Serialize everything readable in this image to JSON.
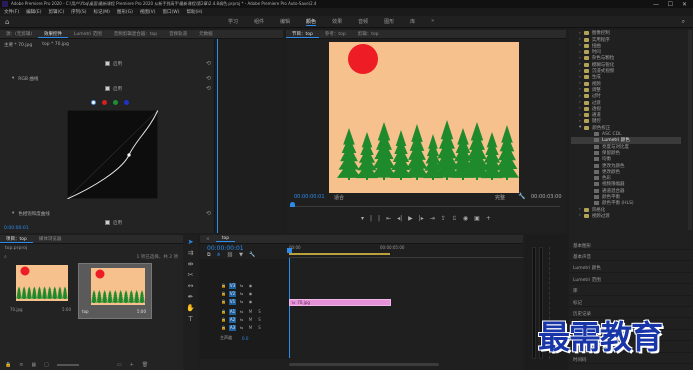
{
  "window": {
    "title": "Adobe Premiere Pro 2020 - C:\\用户\\Ybq\\桌面\\最新课程 Premiere Pro 2020 从新手到高手\\最新课程\\第2章\\2.4.8调色.prproj * - Adobe Premiere Pro Auto-Save\\2.4"
  },
  "menu": [
    "文件(F)",
    "编辑(E)",
    "剪辑(C)",
    "序列(S)",
    "标记(M)",
    "图形(G)",
    "视图(V)",
    "窗口(W)",
    "帮助(H)"
  ],
  "workspaces": [
    "学习",
    "组件",
    "编辑",
    "颜色",
    "效果",
    "音频",
    "图形",
    "库",
    "»"
  ],
  "effect_controls": {
    "tabs": [
      "源：(无剪辑)",
      "效果控件",
      "Lumetri 范围",
      "音频剪辑混合器：top",
      "音频轨道",
      "元数据"
    ],
    "source_label": "主要 * 70.jpg",
    "clip_label": "top * 70.jpg",
    "row_labels": [
      "RGB 曲线",
      "色相饱和度曲线"
    ],
    "checkbox_label": "启用",
    "colors": {
      "white": "#ffffff",
      "red": "#d21f1f",
      "green": "#1d8d3a",
      "blue": "#2232c9"
    },
    "time_value": "0:00:00:01"
  },
  "program": {
    "tabs": [
      "节目：top",
      "参考：top",
      "剪辑：top"
    ],
    "timecode_left": "00:00:00:01",
    "fit_label": "适合",
    "quality_label": "完整",
    "timecode_right": "00:00:03:00",
    "sky_color": "#f6c18d",
    "sun_color": "#ee1c24",
    "tree_color": "#1f8a2c"
  },
  "project": {
    "tabs": [
      "项目：top",
      "媒体浏览器"
    ],
    "project_name": "top.prproj",
    "item_count": "1 项已选择，共 2 项",
    "items": [
      {
        "name": "70.jpg",
        "duration": "5:00"
      },
      {
        "name": "top",
        "duration": "5:00"
      }
    ]
  },
  "timeline": {
    "tab": "top",
    "timecode": "00:00:00:01",
    "ruler_labels": [
      "00:00",
      "00:00:05:00"
    ],
    "video_tracks": [
      "V3",
      "V2",
      "V1"
    ],
    "audio_tracks": [
      "A1",
      "A2",
      "A3"
    ],
    "master_label": "主声道",
    "master_value": "0.0",
    "clip_name": "70.jpg"
  },
  "effects": {
    "items": [
      {
        "label": "图像控制",
        "type": "folder"
      },
      {
        "label": "实用程序",
        "type": "folder"
      },
      {
        "label": "扭曲",
        "type": "folder"
      },
      {
        "label": "时间",
        "type": "folder"
      },
      {
        "label": "杂色与颗粒",
        "type": "folder"
      },
      {
        "label": "模糊与锐化",
        "type": "folder"
      },
      {
        "label": "沉浸式视频",
        "type": "folder"
      },
      {
        "label": "生成",
        "type": "folder"
      },
      {
        "label": "视频",
        "type": "folder"
      },
      {
        "label": "调整",
        "type": "folder"
      },
      {
        "label": "过时",
        "type": "folder"
      },
      {
        "label": "过渡",
        "type": "folder"
      },
      {
        "label": "透视",
        "type": "folder"
      },
      {
        "label": "通道",
        "type": "folder"
      },
      {
        "label": "键控",
        "type": "folder"
      },
      {
        "label": "颜色校正",
        "type": "folder-open"
      },
      {
        "label": "ASC CDL",
        "type": "effect"
      },
      {
        "label": "Lumetri 颜色",
        "type": "effect-selected"
      },
      {
        "label": "亮度与对比度",
        "type": "effect"
      },
      {
        "label": "保留颜色",
        "type": "effect"
      },
      {
        "label": "均衡",
        "type": "effect"
      },
      {
        "label": "更改为颜色",
        "type": "effect"
      },
      {
        "label": "更改颜色",
        "type": "effect"
      },
      {
        "label": "色彩",
        "type": "effect"
      },
      {
        "label": "视频限幅器",
        "type": "effect"
      },
      {
        "label": "通道混合器",
        "type": "effect"
      },
      {
        "label": "颜色平衡",
        "type": "effect"
      },
      {
        "label": "颜色平衡 (HLS)",
        "type": "effect"
      },
      {
        "label": "风格化",
        "type": "folder"
      },
      {
        "label": "视频过渡",
        "type": "folder"
      }
    ],
    "library": [
      "基本图形",
      "基本声音",
      "Lumetri 颜色",
      "Lumetri 范围",
      "库",
      "标记",
      "历史记录",
      "信息",
      "字幕",
      "工作区",
      "时间码"
    ]
  },
  "watermark": "最需教育"
}
